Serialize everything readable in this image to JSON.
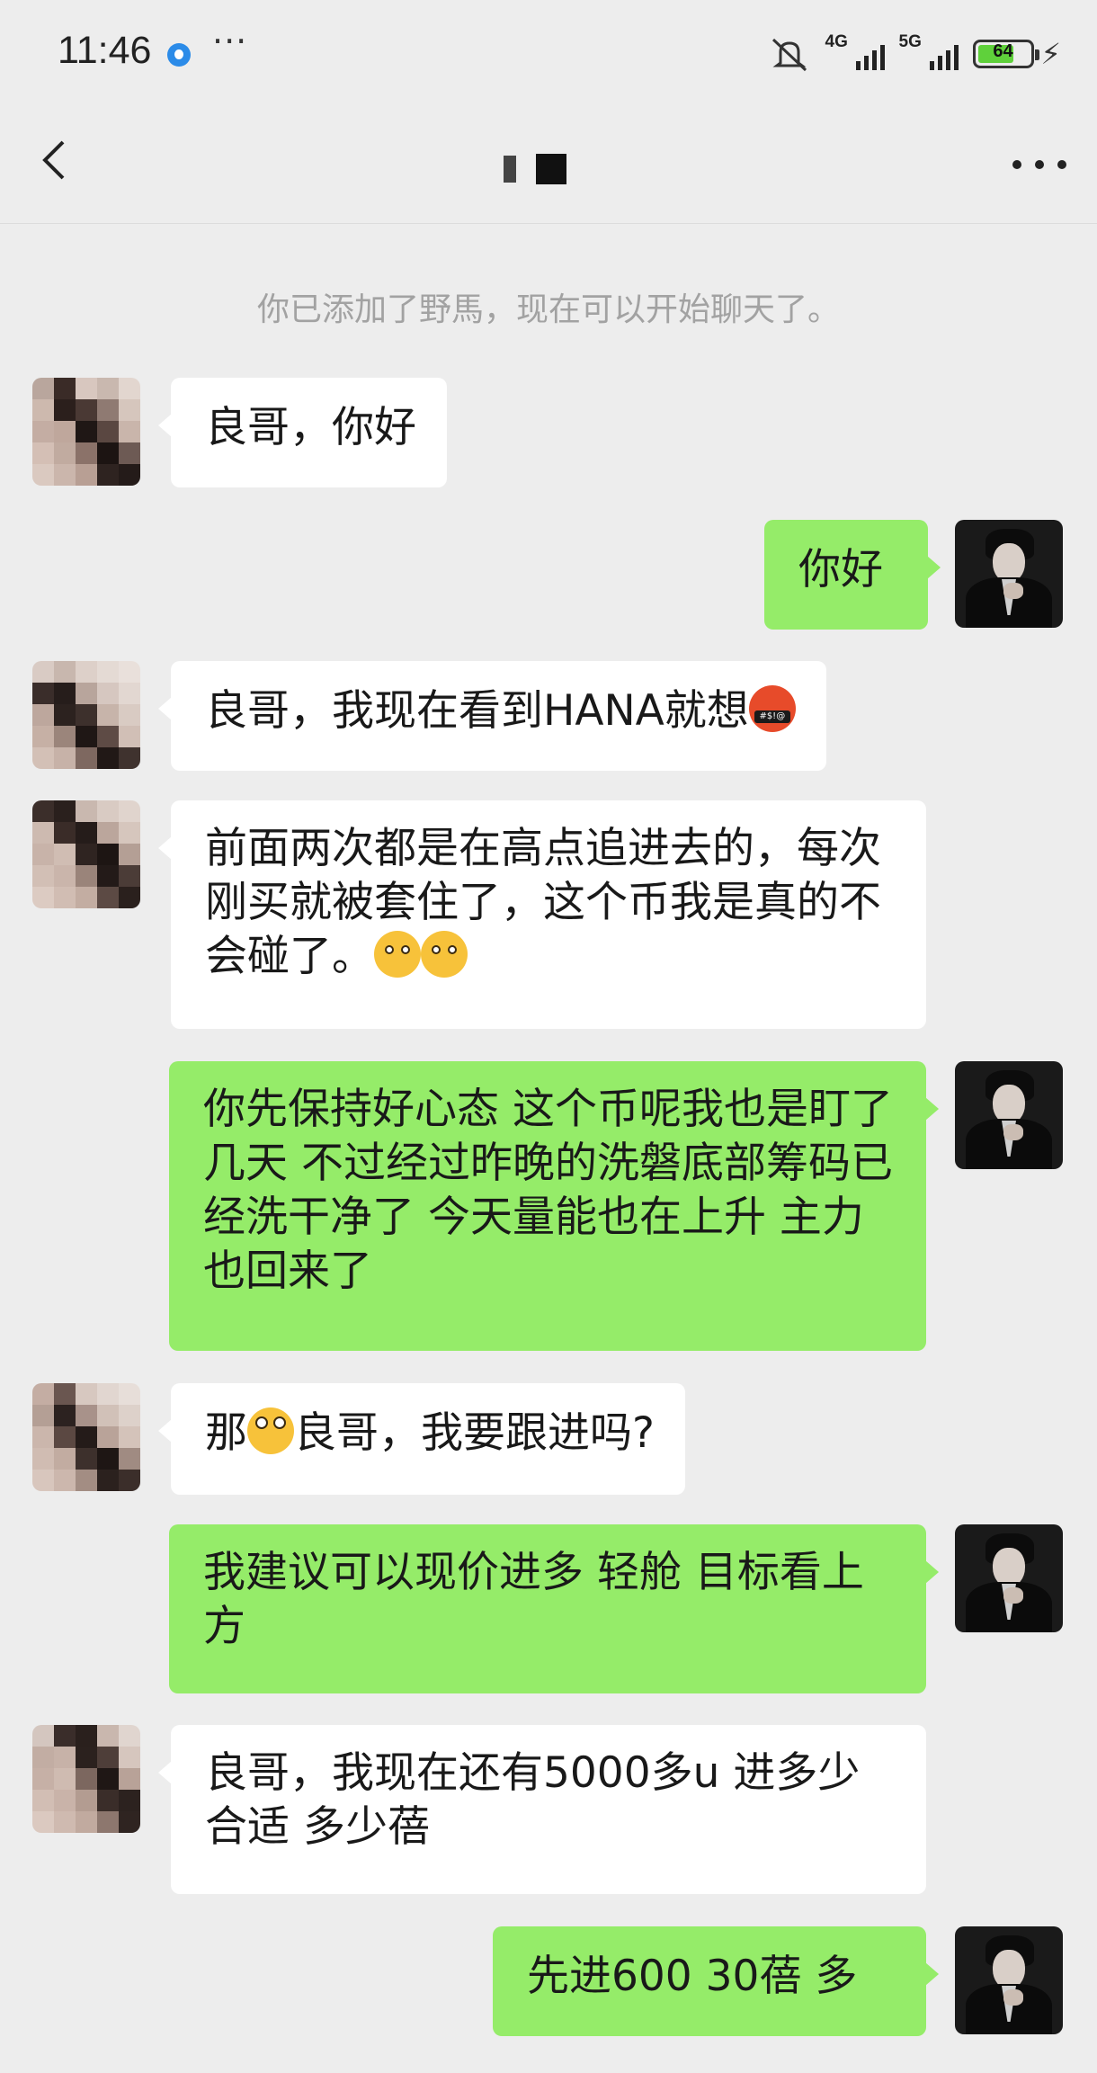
{
  "status_bar": {
    "time": "11:46",
    "network_1": "4G",
    "network_2": "5G",
    "battery": "64"
  },
  "nav": {
    "back_icon": "chevron-left-icon",
    "menu_icon": "more-icon"
  },
  "system_notice": "你已添加了野馬，现在可以开始聊天了。",
  "messages": [
    {
      "side": "in",
      "text": "良哥，你好"
    },
    {
      "side": "out",
      "text": "你好"
    },
    {
      "side": "in",
      "text": "良哥，我现在看到HANA就想",
      "emoji": "face-with-symbols-on-mouth"
    },
    {
      "side": "in",
      "text": "前面两次都是在高点追进去的，每次刚买就被套住了，这个币我是真的不会碰了。",
      "emoji": "melting-face x2"
    },
    {
      "side": "out",
      "text": "你先保持好心态  这个币呢我也是盯了几天 不过经过昨晚的洗磐底部筹码已经洗干净了 今天量能也在上升 主力也回来了"
    },
    {
      "side": "in",
      "text_before": "那",
      "text_after": "良哥，我要跟进吗?",
      "emoji": "face-with-rolling-eyes"
    },
    {
      "side": "out",
      "text": "我建议可以现价进多 轻舱 目标看上方"
    },
    {
      "side": "in",
      "text": "良哥，我现在还有5000多u 进多少合适 多少蓓"
    },
    {
      "side": "out",
      "text": "先进600 30蓓 多"
    }
  ],
  "colors": {
    "background": "#ededed",
    "outgoing_bubble": "#95ec69",
    "incoming_bubble": "#ffffff"
  }
}
